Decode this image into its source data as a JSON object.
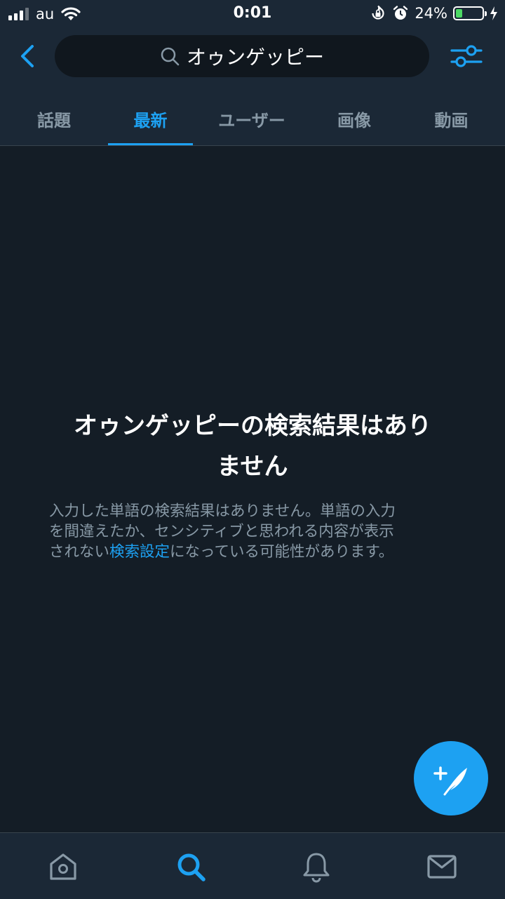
{
  "status": {
    "carrier": "au",
    "time": "0:01",
    "battery_percent_text": "24%",
    "battery_level": 0.24
  },
  "search": {
    "query": "オゥンゲッピー"
  },
  "tabs": [
    {
      "label": "話題",
      "active": false
    },
    {
      "label": "最新",
      "active": true
    },
    {
      "label": "ユーザー",
      "active": false
    },
    {
      "label": "画像",
      "active": false
    },
    {
      "label": "動画",
      "active": false
    }
  ],
  "empty": {
    "title_line1": "オゥンゲッピーの検索結果はあり",
    "title_line2": "ません",
    "desc_line1": "入力した単語の検索結果はありません。単語の入力",
    "desc_line2": "を間違えたか、センシティブと思われる内容が表示",
    "desc_line3_before": "されない",
    "desc_link": "検索設定",
    "desc_line3_after": "になっている可能性があります。"
  },
  "icons": {
    "back": "chevron-left-icon",
    "search": "search-icon",
    "filter": "sliders-icon",
    "compose": "compose-tweet-icon",
    "home": "home-icon",
    "explore": "search-icon",
    "notifications": "bell-icon",
    "messages": "envelope-icon"
  },
  "colors": {
    "accent": "#1da1f2",
    "background": "#141d26",
    "bar": "#1b2836",
    "muted": "#8899a6",
    "battery": "#4cd964"
  }
}
